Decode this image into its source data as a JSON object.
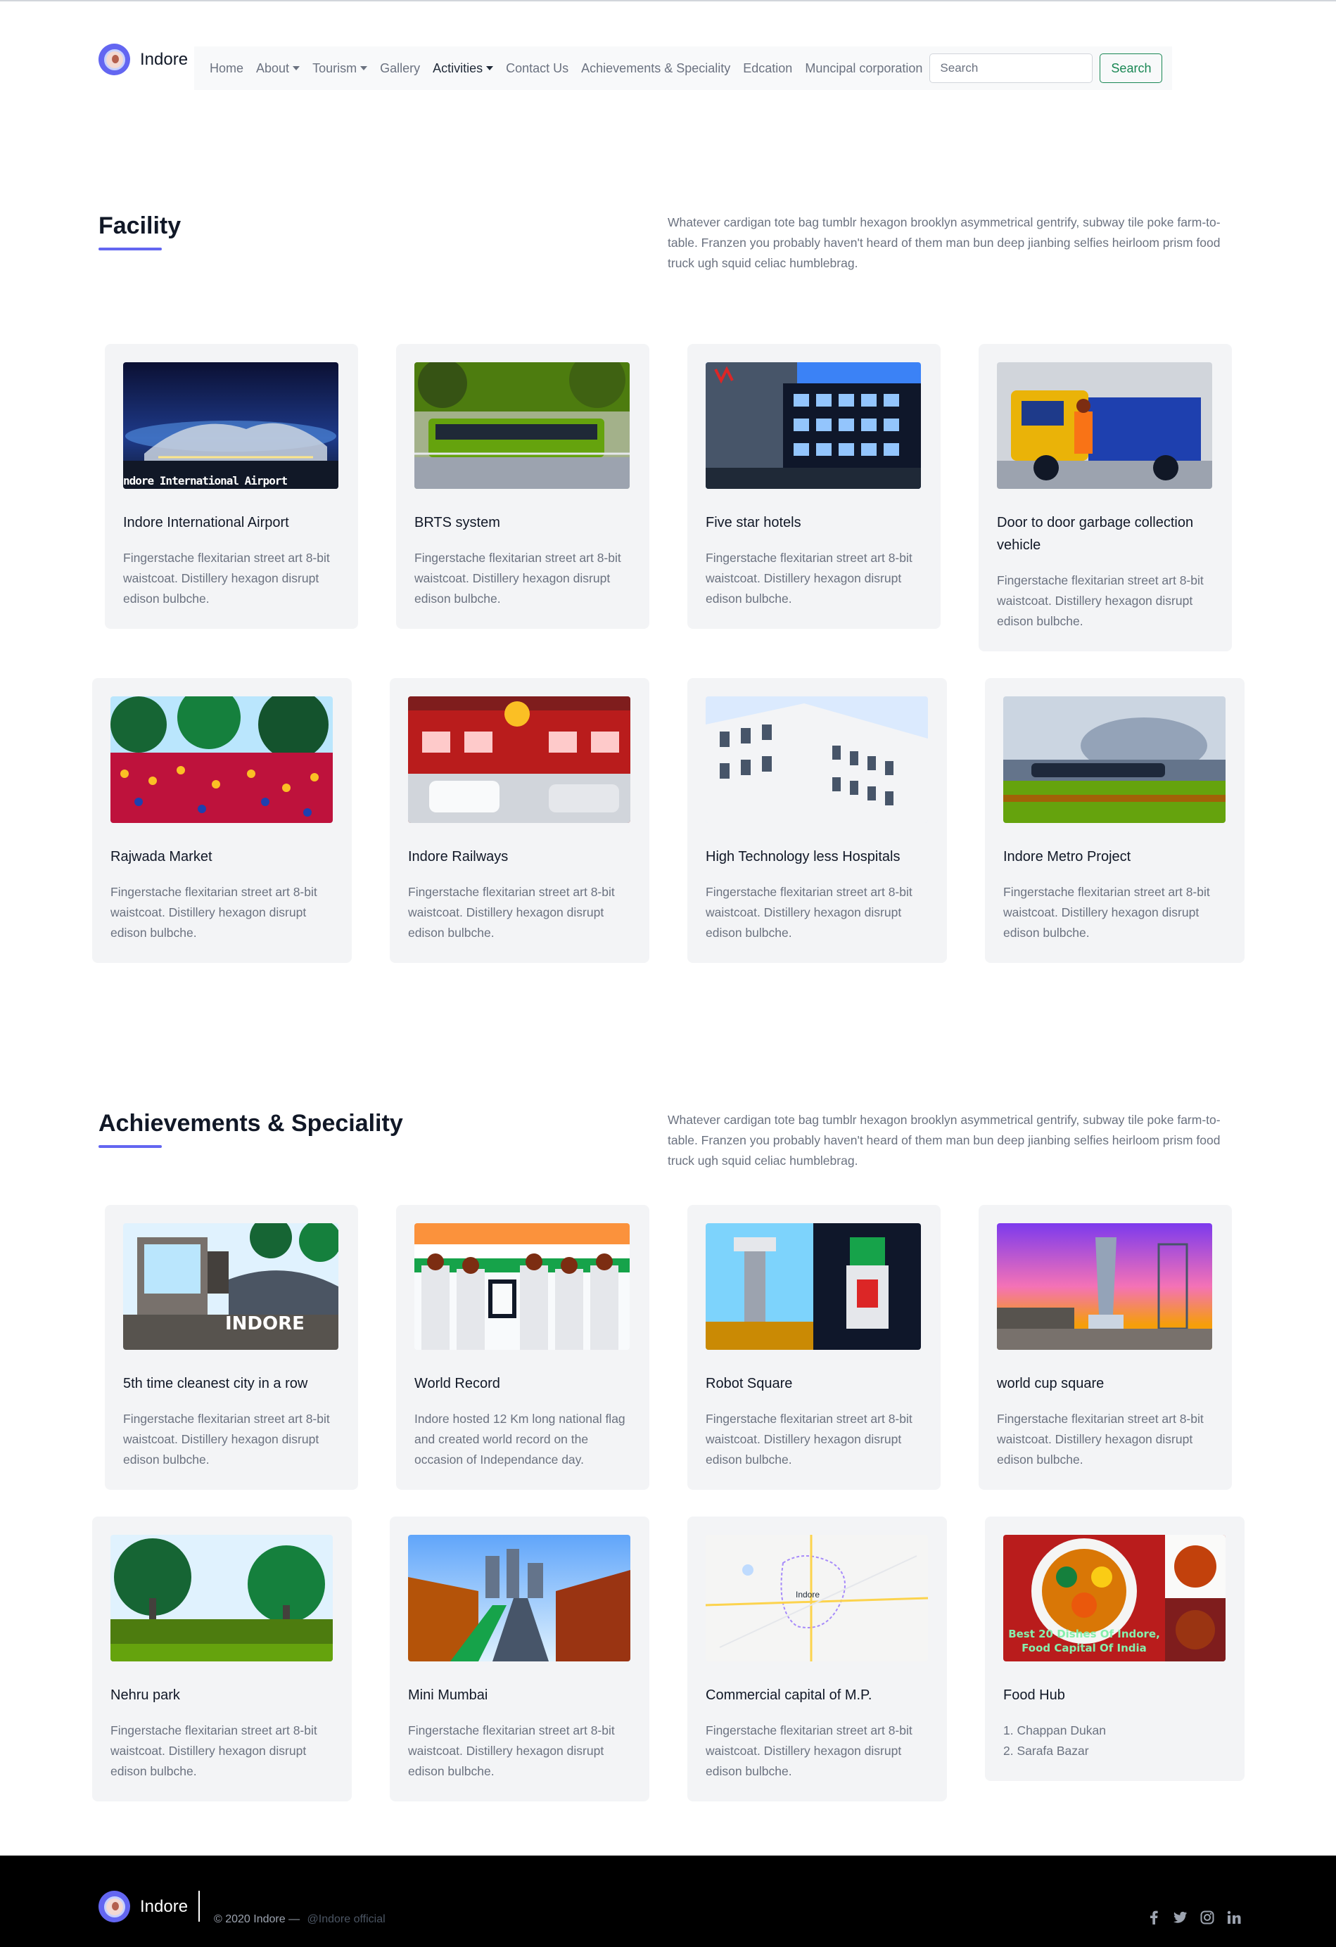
{
  "brand": {
    "name": "Indore"
  },
  "nav": {
    "home": "Home",
    "about": "About",
    "tourism": "Tourism",
    "gallery": "Gallery",
    "activities": "Activities",
    "contact": "Contact Us",
    "achievements": "Achievements & Speciality",
    "education": "Edcation",
    "municipal": "Muncipal corporation",
    "search_placeholder": "Search",
    "search_button": "Search"
  },
  "facility": {
    "title": "Facility",
    "description": "Whatever cardigan tote bag tumblr hexagon brooklyn asymmetrical gentrify, subway tile poke farm-to-table. Franzen you probably haven't heard of them man bun deep jianbing selfies heirloom prism food truck ugh squid celiac humblebrag.",
    "cards": [
      {
        "title": "Indore International Airport",
        "text": "Fingerstache flexitarian street art 8-bit waistcoat. Distillery hexagon disrupt edison bulbche.",
        "image_caption": "ndore International Airport"
      },
      {
        "title": "BRTS system",
        "text": "Fingerstache flexitarian street art 8-bit waistcoat. Distillery hexagon disrupt edison bulbche."
      },
      {
        "title": "Five star hotels",
        "text": "Fingerstache flexitarian street art 8-bit waistcoat. Distillery hexagon disrupt edison bulbche."
      },
      {
        "title": "Door to door garbage collection vehicle",
        "text": "Fingerstache flexitarian street art 8-bit waistcoat. Distillery hexagon disrupt edison bulbche."
      },
      {
        "title": "Rajwada Market",
        "text": "Fingerstache flexitarian street art 8-bit waistcoat. Distillery hexagon disrupt edison bulbche."
      },
      {
        "title": "Indore Railways",
        "text": "Fingerstache flexitarian street art 8-bit waistcoat. Distillery hexagon disrupt edison bulbche."
      },
      {
        "title": "High Technology less Hospitals",
        "text": "Fingerstache flexitarian street art 8-bit waistcoat. Distillery hexagon disrupt edison bulbche."
      },
      {
        "title": "Indore Metro Project",
        "text": "Fingerstache flexitarian street art 8-bit waistcoat. Distillery hexagon disrupt edison bulbche."
      }
    ]
  },
  "achievements": {
    "title": "Achievements & Speciality",
    "description": "Whatever cardigan tote bag tumblr hexagon brooklyn asymmetrical gentrify, subway tile poke farm-to-table. Franzen you probably haven't heard of them man bun deep jianbing selfies heirloom prism food truck ugh squid celiac humblebrag.",
    "cards": [
      {
        "title": "5th time cleanest city in a row",
        "text": "Fingerstache flexitarian street art 8-bit waistcoat. Distillery hexagon disrupt edison bulbche.",
        "image_caption": "INDORE"
      },
      {
        "title": "World Record",
        "text": "Indore hosted 12 Km long national flag and created world record on the occasion of Independance day."
      },
      {
        "title": "Robot Square",
        "text": "Fingerstache flexitarian street art 8-bit waistcoat. Distillery hexagon disrupt edison bulbche."
      },
      {
        "title": "world cup square",
        "text": "Fingerstache flexitarian street art 8-bit waistcoat. Distillery hexagon disrupt edison bulbche."
      },
      {
        "title": "Nehru park",
        "text": "Fingerstache flexitarian street art 8-bit waistcoat. Distillery hexagon disrupt edison bulbche."
      },
      {
        "title": "Mini Mumbai",
        "text": "Fingerstache flexitarian street art 8-bit waistcoat. Distillery hexagon disrupt edison bulbche."
      },
      {
        "title": "Commercial capital of M.P.",
        "text": "Fingerstache flexitarian street art 8-bit waistcoat. Distillery hexagon disrupt edison bulbche.",
        "image_caption": "Indore"
      },
      {
        "title": "Food Hub",
        "text_line1": "1. Chappan Dukan",
        "text_line2": "2. Sarafa Bazar",
        "image_caption_line1": "Best 20 Dishes Of Indore,",
        "image_caption_line2": "Food Capital Of India"
      }
    ]
  },
  "footer": {
    "brand": "Indore",
    "copyright": "© 2020 Indore —",
    "handle": "@Indore official",
    "social_icons": [
      "facebook-icon",
      "twitter-icon",
      "instagram-icon",
      "linkedin-icon"
    ]
  },
  "colors": {
    "accent": "#6366f1",
    "search_button": "#198754",
    "card_bg": "#f3f4f6",
    "footer_bg": "#000000"
  }
}
